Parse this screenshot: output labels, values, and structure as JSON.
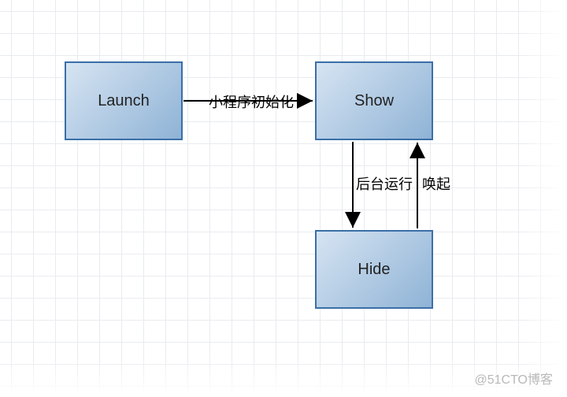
{
  "nodes": {
    "launch": {
      "label": "Launch"
    },
    "show": {
      "label": "Show"
    },
    "hide": {
      "label": "Hide"
    }
  },
  "edges": {
    "init": {
      "label": "小程序初始化"
    },
    "to_back": {
      "label": "后台运行"
    },
    "wake": {
      "label": "唤起"
    }
  },
  "watermark": "@51CTO博客"
}
